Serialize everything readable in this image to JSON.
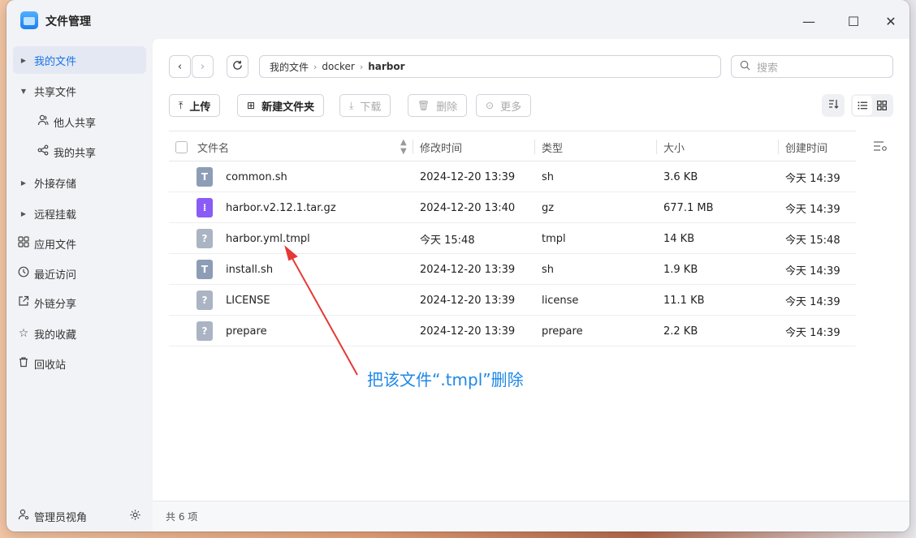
{
  "app": {
    "title": "文件管理"
  },
  "window_controls": {
    "minimize": "—",
    "maximize": "☐",
    "close": "✕"
  },
  "sidebar": {
    "items": [
      {
        "label": "我的文件",
        "icon": "caret-right",
        "active": true
      },
      {
        "label": "共享文件",
        "icon": "caret-down",
        "active": false
      },
      {
        "label": "他人共享",
        "icon": "users-icon",
        "active": false
      },
      {
        "label": "我的共享",
        "icon": "share-icon",
        "active": false
      },
      {
        "label": "外接存储",
        "icon": "caret-right",
        "active": false
      },
      {
        "label": "远程挂载",
        "icon": "caret-right",
        "active": false
      },
      {
        "label": "应用文件",
        "icon": "apps-icon",
        "active": false
      },
      {
        "label": "最近访问",
        "icon": "clock-icon",
        "active": false
      },
      {
        "label": "外链分享",
        "icon": "external-link-icon",
        "active": false
      },
      {
        "label": "我的收藏",
        "icon": "star-icon",
        "active": false
      },
      {
        "label": "回收站",
        "icon": "trash-icon",
        "active": false
      }
    ],
    "footer": {
      "label": "管理员视角"
    }
  },
  "path": [
    "我的文件",
    "docker",
    "harbor"
  ],
  "search": {
    "placeholder": "搜索"
  },
  "actions": {
    "upload": "上传",
    "new_folder": "新建文件夹",
    "download": "下载",
    "delete": "删除",
    "more": "更多"
  },
  "table": {
    "headers": [
      "文件名",
      "修改时间",
      "类型",
      "大小",
      "创建时间"
    ],
    "rows": [
      {
        "name": "common.sh",
        "modified": "2024-12-20 13:39",
        "type": "sh",
        "size": "3.6 KB",
        "created": "今天 14:39",
        "icon": "text-file-icon"
      },
      {
        "name": "harbor.v2.12.1.tar.gz",
        "modified": "2024-12-20 13:40",
        "type": "gz",
        "size": "677.1 MB",
        "created": "今天 14:39",
        "icon": "archive-file-icon"
      },
      {
        "name": "harbor.yml.tmpl",
        "modified": "今天 15:48",
        "type": "tmpl",
        "size": "14 KB",
        "created": "今天 15:48",
        "icon": "unknown-file-icon"
      },
      {
        "name": "install.sh",
        "modified": "2024-12-20 13:39",
        "type": "sh",
        "size": "1.9 KB",
        "created": "今天 14:39",
        "icon": "text-file-icon"
      },
      {
        "name": "LICENSE",
        "modified": "2024-12-20 13:39",
        "type": "license",
        "size": "11.1 KB",
        "created": "今天 14:39",
        "icon": "unknown-file-icon"
      },
      {
        "name": "prepare",
        "modified": "2024-12-20 13:39",
        "type": "prepare",
        "size": "2.2 KB",
        "created": "今天 14:39",
        "icon": "unknown-file-icon"
      }
    ]
  },
  "status": {
    "count": "共 6 项"
  },
  "annotation": {
    "text": "把该文件“.tmpl”删除",
    "color": "#1e88e5",
    "arrow_color": "#e53935"
  }
}
